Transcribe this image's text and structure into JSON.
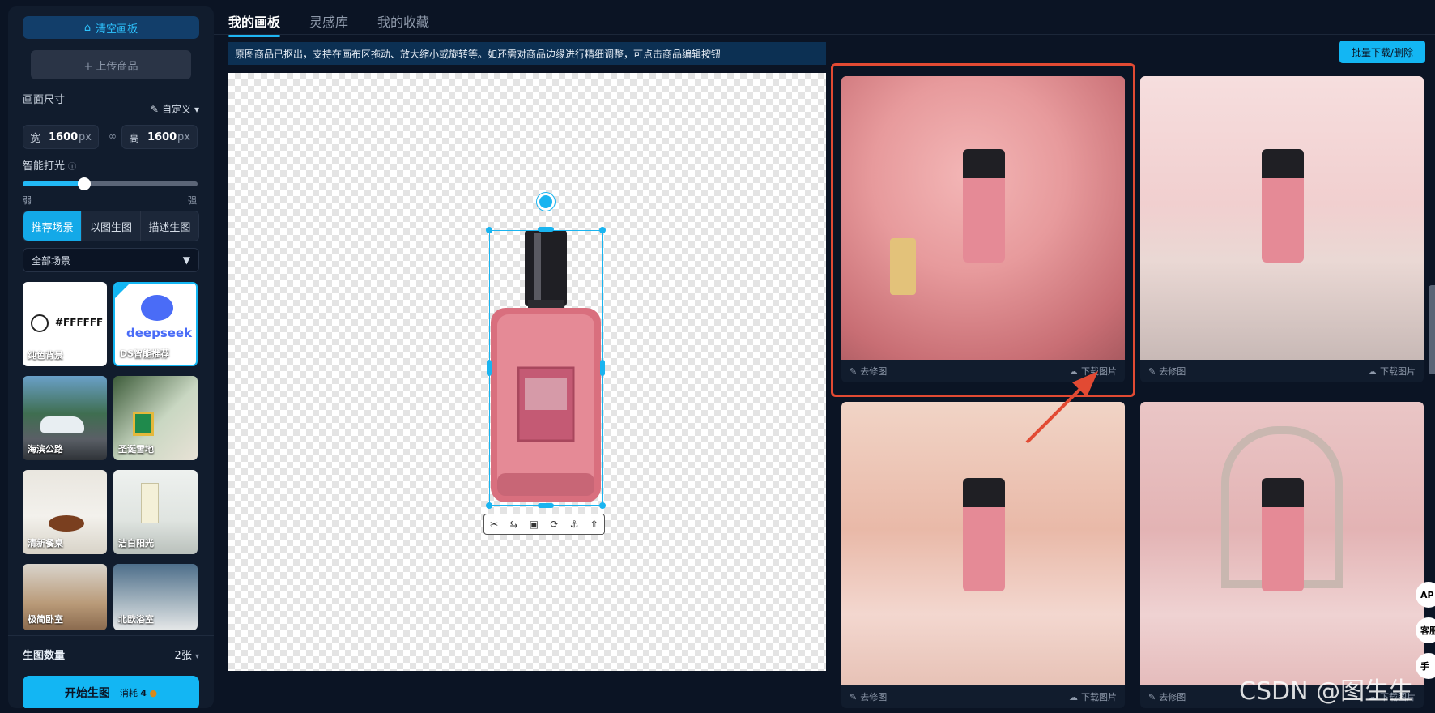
{
  "sidebar": {
    "clear_canvas": "清空画板",
    "upload_product": "+ 上传商品",
    "canvas_size_label": "画面尺寸",
    "custom_label": "自定义",
    "width_key": "宽",
    "width_value": "1600",
    "height_key": "高",
    "height_value": "1600",
    "unit": "px",
    "lighting_label": "智能打光",
    "lighting_level": 0.35,
    "weak": "弱",
    "strong": "强",
    "mode_tabs": [
      "推荐场景",
      "以图生图",
      "描述生图"
    ],
    "scene_filter": "全部场景",
    "scenes": [
      {
        "label": "纯色背景",
        "swatch": "#FFFFFF"
      },
      {
        "label": "DS智能推荐",
        "brand": "deepseek"
      },
      {
        "label": "海滨公路"
      },
      {
        "label": "圣诞雪地"
      },
      {
        "label": "清新餐桌"
      },
      {
        "label": "洁白阳光"
      },
      {
        "label": "极简卧室"
      },
      {
        "label": "北欧浴室"
      }
    ],
    "count_label": "生图数量",
    "count_value": "2张",
    "start_button": "开始生图",
    "cost_label": "消耗",
    "cost_value": "4"
  },
  "tabs": [
    "我的画板",
    "灵感库",
    "我的收藏"
  ],
  "notice": "原图商品已抠出，支持在画布区拖动、放大缩小或旋转等。如还需对商品边缘进行精细调整，可点击商品编辑按钮",
  "batch_button": "批量下载/删除",
  "result_actions": {
    "edit": "去修图",
    "download": "下载图片"
  },
  "side_pills": [
    "AP",
    "客服",
    "手"
  ],
  "watermark": "CSDN @图生生",
  "colors": {
    "accent": "#13b6f3",
    "highlight": "#e24a33",
    "background": "#0b1424"
  }
}
